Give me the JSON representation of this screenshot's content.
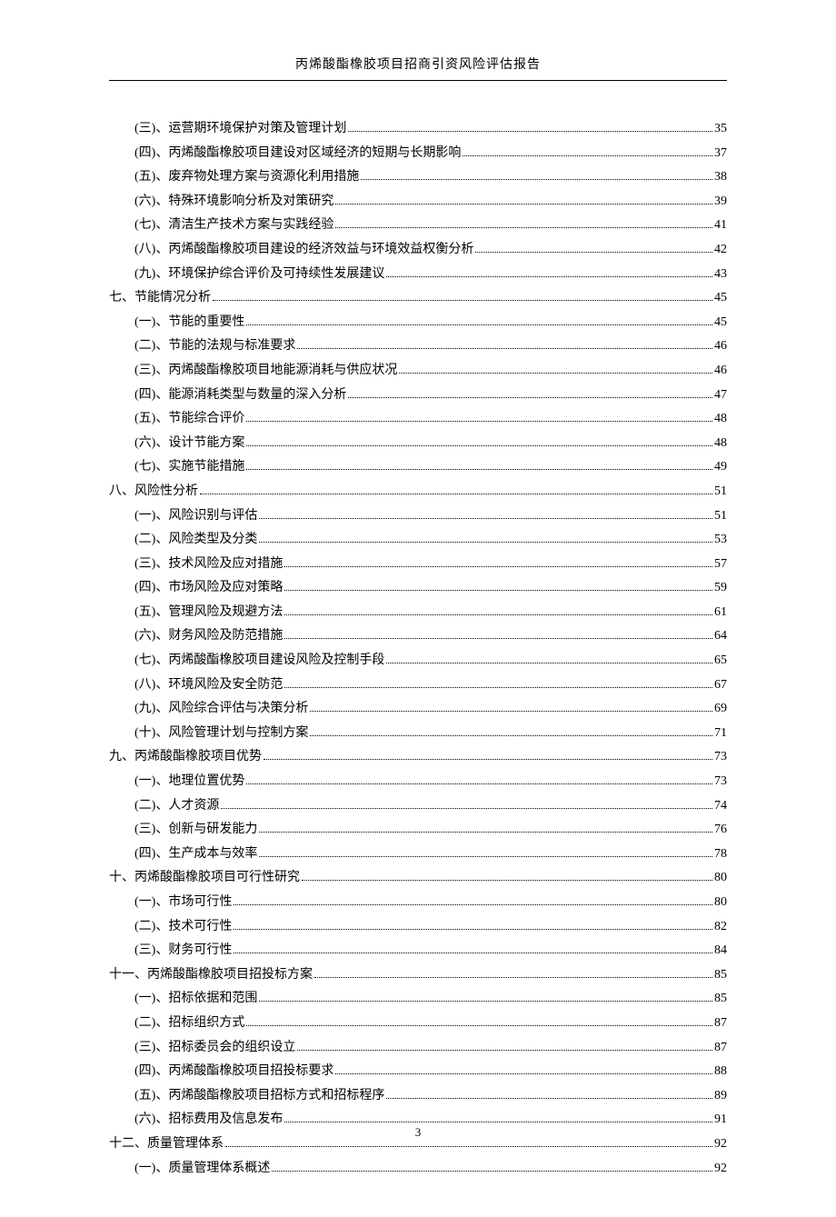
{
  "header": "丙烯酸酯橡胶项目招商引资风险评估报告",
  "page_number": "3",
  "toc": [
    {
      "level": 1,
      "label": "(三)、运营期环境保护对策及管理计划",
      "page": "35"
    },
    {
      "level": 1,
      "label": "(四)、丙烯酸酯橡胶项目建设对区域经济的短期与长期影响",
      "page": "37"
    },
    {
      "level": 1,
      "label": "(五)、废弃物处理方案与资源化利用措施",
      "page": "38"
    },
    {
      "level": 1,
      "label": "(六)、特殊环境影响分析及对策研究",
      "page": "39"
    },
    {
      "level": 1,
      "label": "(七)、清洁生产技术方案与实践经验",
      "page": "41"
    },
    {
      "level": 1,
      "label": "(八)、丙烯酸酯橡胶项目建设的经济效益与环境效益权衡分析",
      "page": "42"
    },
    {
      "level": 1,
      "label": "(九)、环境保护综合评价及可持续性发展建议",
      "page": "43"
    },
    {
      "level": 0,
      "label": "七、节能情况分析",
      "page": "45"
    },
    {
      "level": 1,
      "label": "(一)、节能的重要性",
      "page": "45"
    },
    {
      "level": 1,
      "label": "(二)、节能的法规与标准要求",
      "page": "46"
    },
    {
      "level": 1,
      "label": "(三)、丙烯酸酯橡胶项目地能源消耗与供应状况",
      "page": "46"
    },
    {
      "level": 1,
      "label": "(四)、能源消耗类型与数量的深入分析",
      "page": "47"
    },
    {
      "level": 1,
      "label": "(五)、节能综合评价",
      "page": "48"
    },
    {
      "level": 1,
      "label": "(六)、设计节能方案",
      "page": "48"
    },
    {
      "level": 1,
      "label": "(七)、实施节能措施",
      "page": "49"
    },
    {
      "level": 0,
      "label": "八、风险性分析",
      "page": "51"
    },
    {
      "level": 1,
      "label": "(一)、风险识别与评估",
      "page": "51"
    },
    {
      "level": 1,
      "label": "(二)、风险类型及分类",
      "page": "53"
    },
    {
      "level": 1,
      "label": "(三)、技术风险及应对措施",
      "page": "57"
    },
    {
      "level": 1,
      "label": "(四)、市场风险及应对策略",
      "page": "59"
    },
    {
      "level": 1,
      "label": "(五)、管理风险及规避方法",
      "page": "61"
    },
    {
      "level": 1,
      "label": "(六)、财务风险及防范措施",
      "page": "64"
    },
    {
      "level": 1,
      "label": "(七)、丙烯酸酯橡胶项目建设风险及控制手段",
      "page": "65"
    },
    {
      "level": 1,
      "label": "(八)、环境风险及安全防范",
      "page": "67"
    },
    {
      "level": 1,
      "label": "(九)、风险综合评估与决策分析",
      "page": "69"
    },
    {
      "level": 1,
      "label": "(十)、风险管理计划与控制方案",
      "page": "71"
    },
    {
      "level": 0,
      "label": "九、丙烯酸酯橡胶项目优势",
      "page": "73"
    },
    {
      "level": 1,
      "label": "(一)、地理位置优势",
      "page": "73"
    },
    {
      "level": 1,
      "label": "(二)、人才资源",
      "page": "74"
    },
    {
      "level": 1,
      "label": "(三)、创新与研发能力",
      "page": "76"
    },
    {
      "level": 1,
      "label": "(四)、生产成本与效率",
      "page": "78"
    },
    {
      "level": 0,
      "label": "十、丙烯酸酯橡胶项目可行性研究",
      "page": "80"
    },
    {
      "level": 1,
      "label": "(一)、市场可行性",
      "page": "80"
    },
    {
      "level": 1,
      "label": "(二)、技术可行性",
      "page": "82"
    },
    {
      "level": 1,
      "label": "(三)、财务可行性",
      "page": "84"
    },
    {
      "level": 0,
      "label": "十一、丙烯酸酯橡胶项目招投标方案",
      "page": "85"
    },
    {
      "level": 1,
      "label": "(一)、招标依据和范围",
      "page": "85"
    },
    {
      "level": 1,
      "label": "(二)、招标组织方式",
      "page": "87"
    },
    {
      "level": 1,
      "label": "(三)、招标委员会的组织设立",
      "page": "87"
    },
    {
      "level": 1,
      "label": "(四)、丙烯酸酯橡胶项目招投标要求",
      "page": "88"
    },
    {
      "level": 1,
      "label": "(五)、丙烯酸酯橡胶项目招标方式和招标程序",
      "page": "89"
    },
    {
      "level": 1,
      "label": "(六)、招标费用及信息发布",
      "page": "91"
    },
    {
      "level": 0,
      "label": "十二、质量管理体系",
      "page": "92"
    },
    {
      "level": 1,
      "label": "(一)、质量管理体系概述",
      "page": "92"
    }
  ]
}
